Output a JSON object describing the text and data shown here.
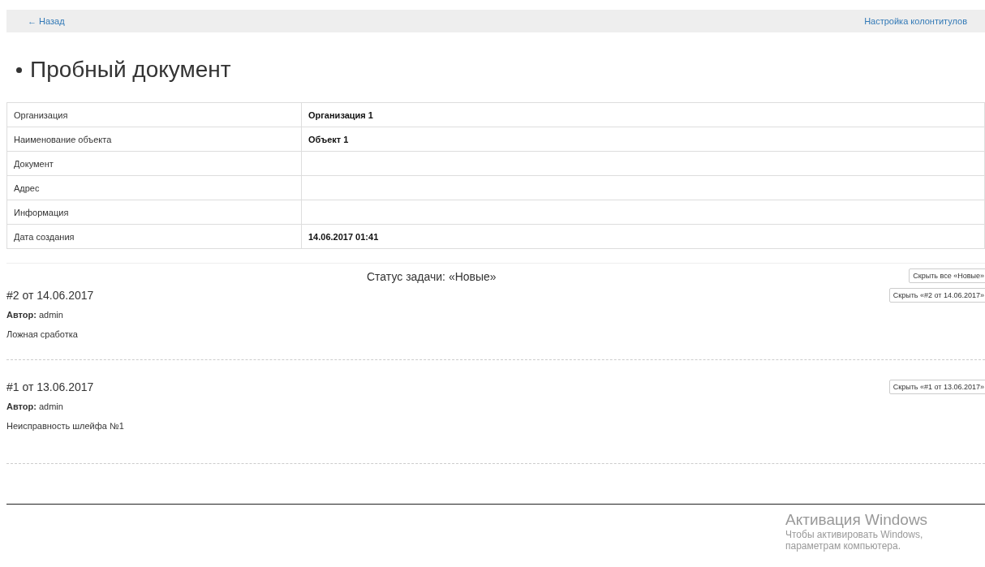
{
  "top_bar": {
    "back_link": "← Назад",
    "settings_link": "Настройка колонтитулов"
  },
  "title": "Пробный документ",
  "info_table": {
    "rows": [
      {
        "label": "Организация",
        "value": "Организация 1"
      },
      {
        "label": "Наименование объекта",
        "value": "Объект 1"
      },
      {
        "label": "Документ",
        "value": ""
      },
      {
        "label": "Адрес",
        "value": ""
      },
      {
        "label": "Информация",
        "value": ""
      },
      {
        "label": "Дата создания",
        "value": "14.06.2017 01:41"
      }
    ]
  },
  "status_group": {
    "heading": "Статус задачи: «Новые»",
    "hide_all_button": "Скрыть все «Новые»",
    "tasks": [
      {
        "title": "#2 от 14.06.2017",
        "hide_button": "Скрыть «#2 от 14.06.2017»",
        "author_label": "Автор:",
        "author": "admin",
        "text": "Ложная сработка"
      },
      {
        "title": "#1 от 13.06.2017",
        "hide_button": "Скрыть «#1 от 13.06.2017»",
        "author_label": "Автор:",
        "author": "admin",
        "text": "Неисправность шлейфа №1"
      }
    ]
  },
  "os_overlay": {
    "title": "Активация Windows",
    "lines": [
      "Чтобы активировать Windows,",
      "параметрам компьютера."
    ]
  }
}
